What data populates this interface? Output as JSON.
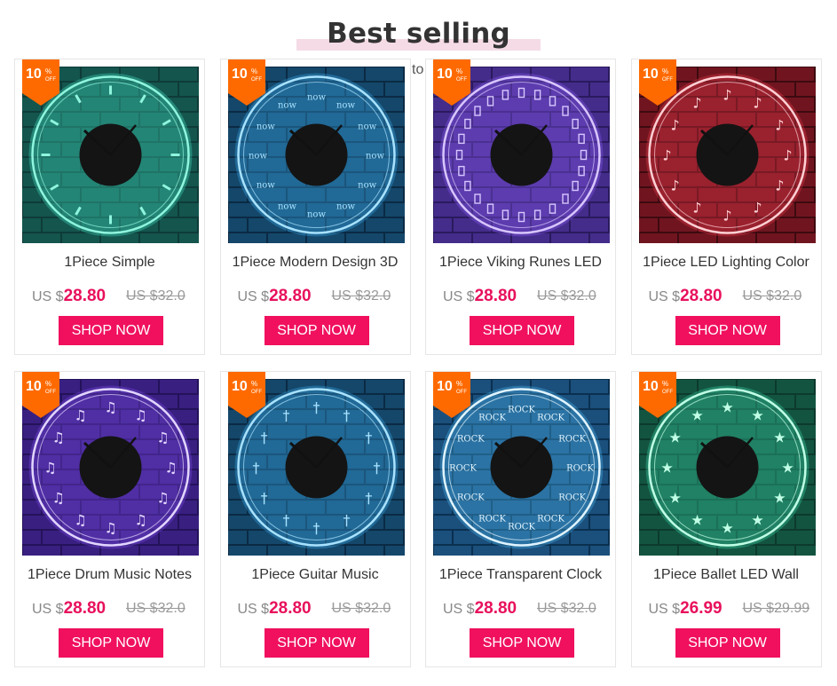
{
  "section": {
    "title": "Best selling",
    "stray_text": "to"
  },
  "badge": {
    "percent": "10",
    "percent_sign": "%",
    "off": "OFF",
    "color": "#ff6a00"
  },
  "colors": {
    "accent": "#f0105e",
    "price": "#e8105c"
  },
  "products": [
    {
      "name": "1Piece Simple",
      "currency": "US $",
      "price": "28.80",
      "old_price": "US $32.0",
      "button": "SHOP NOW",
      "theme": "teal",
      "dial": "ticks"
    },
    {
      "name": "1Piece Modern Design 3D",
      "currency": "US $",
      "price": "28.80",
      "old_price": "US $32.0",
      "button": "SHOP NOW",
      "theme": "blue",
      "dial": "now",
      "dial_word": "now"
    },
    {
      "name": "1Piece Viking Runes LED",
      "currency": "US $",
      "price": "28.80",
      "old_price": "US $32.0",
      "button": "SHOP NOW",
      "theme": "purple",
      "dial": "runes"
    },
    {
      "name": "1Piece LED Lighting Color",
      "currency": "US $",
      "price": "28.80",
      "old_price": "US $32.0",
      "button": "SHOP NOW",
      "theme": "red",
      "dial": "music"
    },
    {
      "name": "1Piece Drum Music Notes",
      "currency": "US $",
      "price": "28.80",
      "old_price": "US $32.0",
      "button": "SHOP NOW",
      "theme": "violet",
      "dial": "drum"
    },
    {
      "name": "1Piece Guitar Music",
      "currency": "US $",
      "price": "28.80",
      "old_price": "US $32.0",
      "button": "SHOP NOW",
      "theme": "blue",
      "dial": "guitar"
    },
    {
      "name": "1Piece Transparent Clock",
      "currency": "US $",
      "price": "28.80",
      "old_price": "US $32.0",
      "button": "SHOP NOW",
      "theme": "sky",
      "dial": "rock",
      "dial_word": "ROCK"
    },
    {
      "name": "1Piece Ballet LED Wall",
      "currency": "US $",
      "price": "26.99",
      "old_price": "US $29.99",
      "button": "SHOP NOW",
      "theme": "green",
      "dial": "ballet"
    }
  ]
}
